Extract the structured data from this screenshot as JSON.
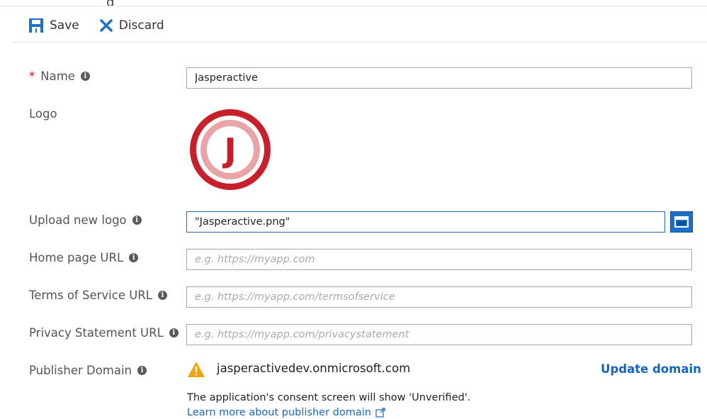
{
  "header": {
    "partial_title": "g"
  },
  "toolbar": {
    "save_label": "Save",
    "discard_label": "Discard"
  },
  "form": {
    "name": {
      "label": "Name",
      "required_marker": "*",
      "value": "Jasperactive"
    },
    "logo": {
      "label": "Logo",
      "logo_letter": "J"
    },
    "upload_logo": {
      "label": "Upload new logo",
      "value": "\"Jasperactive.png\""
    },
    "home_page_url": {
      "label": "Home page URL",
      "placeholder": "e.g. https://myapp.com"
    },
    "terms_url": {
      "label": "Terms of Service URL",
      "placeholder": "e.g. https://myapp.com/termsofservice"
    },
    "privacy_url": {
      "label": "Privacy Statement URL",
      "placeholder": "e.g. https://myapp.com/privacystatement"
    },
    "publisher_domain": {
      "label": "Publisher Domain",
      "value": "jasperactivedev.onmicrosoft.com",
      "update_label": "Update domain",
      "consent_note": "The application's consent screen will show 'Unverified'.",
      "learn_more": "Learn more about publisher domain"
    }
  },
  "info_icon_glyph": "i",
  "colors": {
    "accent": "#1d6fc9",
    "link": "#1a68bd",
    "required": "#e00000",
    "warning": "#f2a20c",
    "logo_red": "#c8202b"
  }
}
